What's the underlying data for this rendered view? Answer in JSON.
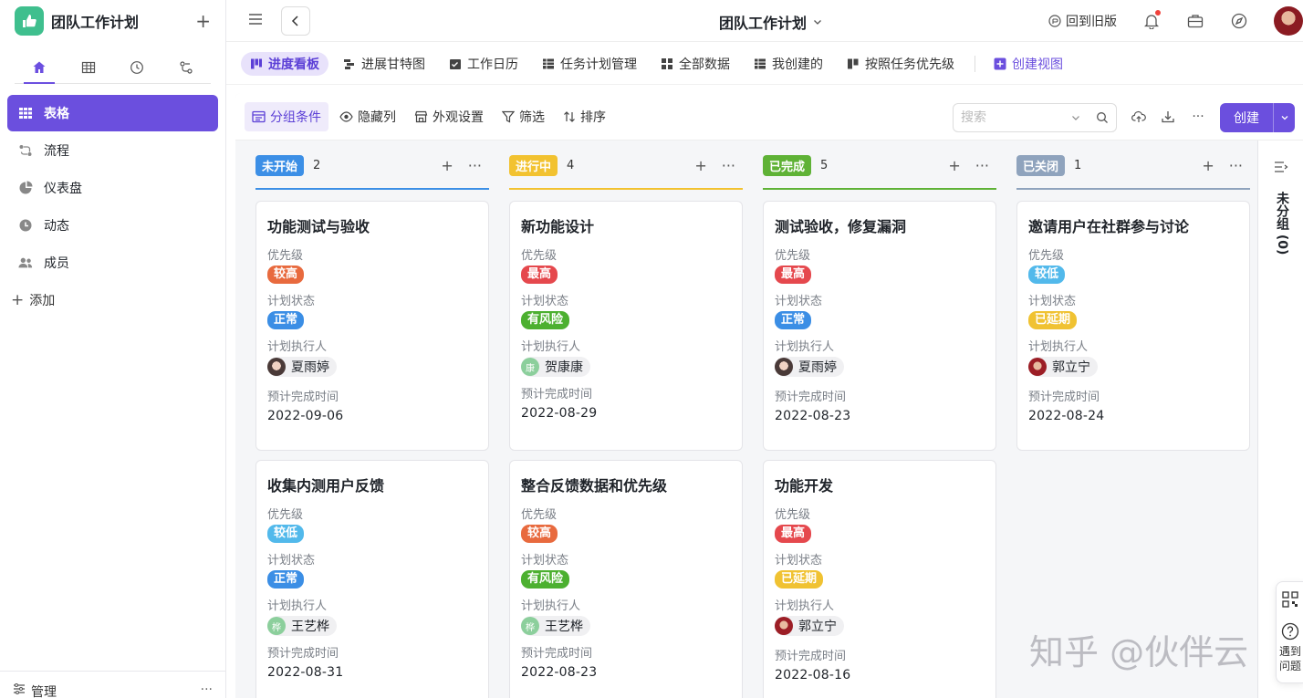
{
  "app": {
    "title": "团队工作计划",
    "add_symbol": "+"
  },
  "sidebar": {
    "items": [
      {
        "label": "表格",
        "icon": "grid-icon",
        "active": true
      },
      {
        "label": "流程",
        "icon": "flow-icon"
      },
      {
        "label": "仪表盘",
        "icon": "dashboard-icon"
      },
      {
        "label": "动态",
        "icon": "clock-icon"
      },
      {
        "label": "成员",
        "icon": "members-icon"
      }
    ],
    "add_label": "添加",
    "footer_label": "管理",
    "footer_more": "···"
  },
  "topbar": {
    "title": "团队工作计划",
    "old_version": "回到旧版"
  },
  "views": [
    {
      "label": "进度看板",
      "active": true
    },
    {
      "label": "进展甘特图"
    },
    {
      "label": "工作日历"
    },
    {
      "label": "任务计划管理"
    },
    {
      "label": "全部数据"
    },
    {
      "label": "我创建的"
    },
    {
      "label": "按照任务优先级"
    }
  ],
  "create_view_label": "创建视图",
  "toolbar": {
    "group": "分组条件",
    "hide_columns": "隐藏列",
    "appearance": "外观设置",
    "filter": "筛选",
    "sort": "排序",
    "search_placeholder": "搜索",
    "create": "创建",
    "more": "···"
  },
  "field_labels": {
    "priority": "优先级",
    "plan_status": "计划状态",
    "assignee": "计划执行人",
    "due": "预计完成时间"
  },
  "colors": {
    "accent": "#6b4fde",
    "not_started": "#3c8fe6",
    "in_progress": "#f2c230",
    "done": "#5fb236",
    "closed": "#8fa3bd",
    "tag_higher": "#e86a3e",
    "tag_highest": "#e5484d",
    "tag_lower": "#52b9eb",
    "tag_normal": "#3b8ee5",
    "tag_risk": "#4cb030",
    "tag_delayed": "#f0c232"
  },
  "columns": [
    {
      "name": "未开始",
      "count": "2",
      "color": "#3c8fe6",
      "cards": [
        {
          "title": "功能测试与验收",
          "priority": "较高",
          "priority_color": "#e86a3e",
          "status": "正常",
          "status_color": "#3b8ee5",
          "assignee": "夏雨婷",
          "avatar": "photo-woman",
          "due": "2022-09-06"
        },
        {
          "title": "收集内测用户反馈",
          "priority": "较低",
          "priority_color": "#52b9eb",
          "status": "正常",
          "status_color": "#3b8ee5",
          "assignee": "王艺桦",
          "avatar": "桦",
          "avatar_color": "#8ccf9c",
          "due": "2022-08-31"
        }
      ]
    },
    {
      "name": "进行中",
      "count": "4",
      "color": "#f2c230",
      "cards": [
        {
          "title": "新功能设计",
          "priority": "最高",
          "priority_color": "#e5484d",
          "status": "有风险",
          "status_color": "#4cb030",
          "assignee": "贺康康",
          "avatar": "康",
          "avatar_color": "#8ccf9c",
          "due": "2022-08-29"
        },
        {
          "title": "整合反馈数据和优先级",
          "priority": "较高",
          "priority_color": "#e86a3e",
          "status": "有风险",
          "status_color": "#4cb030",
          "assignee": "王艺桦",
          "avatar": "桦",
          "avatar_color": "#8ccf9c",
          "due": "2022-08-23"
        }
      ]
    },
    {
      "name": "已完成",
      "count": "5",
      "color": "#5fb236",
      "cards": [
        {
          "title": "测试验收，修复漏洞",
          "priority": "最高",
          "priority_color": "#e5484d",
          "status": "正常",
          "status_color": "#3b8ee5",
          "assignee": "夏雨婷",
          "avatar": "photo-woman",
          "due": "2022-08-23"
        },
        {
          "title": "功能开发",
          "priority": "最高",
          "priority_color": "#e5484d",
          "status": "已延期",
          "status_color": "#f0c232",
          "assignee": "郭立宁",
          "avatar": "photo-red",
          "due": "2022-08-16"
        }
      ]
    },
    {
      "name": "已关闭",
      "count": "1",
      "color": "#8fa3bd",
      "cards": [
        {
          "title": "邀请用户在社群参与讨论",
          "priority": "较低",
          "priority_color": "#52b9eb",
          "status": "已延期",
          "status_color": "#f0c232",
          "assignee": "郭立宁",
          "avatar": "photo-red",
          "due": "2022-08-24"
        }
      ]
    }
  ],
  "unassigned_label": "未分组 (0)",
  "float_panel_text": "遇到问题",
  "watermark": "知乎 @伙伴云"
}
